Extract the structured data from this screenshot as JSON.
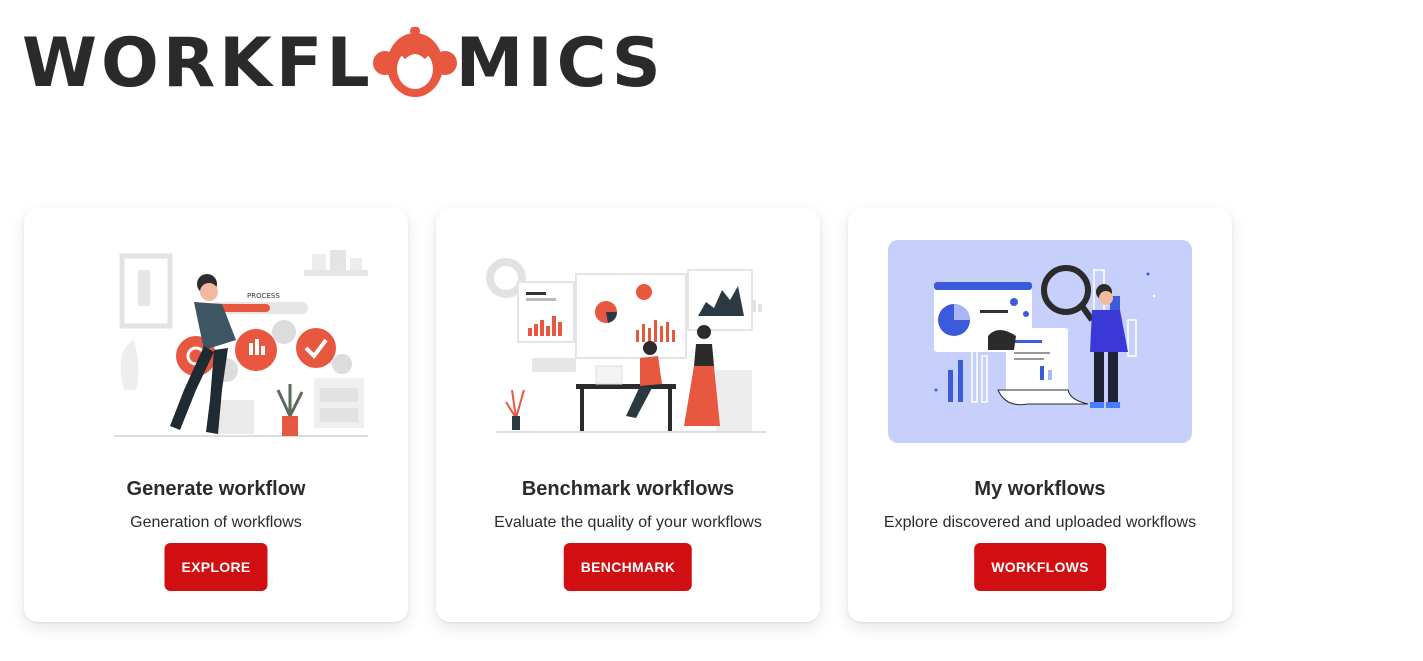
{
  "logo": {
    "text_left": "WORKFL",
    "text_right": "MICS"
  },
  "colors": {
    "accent": "#d10f12",
    "logo_orange": "#e8573f",
    "illustration_bg": "#c7cffb"
  },
  "cards": [
    {
      "title": "Generate workflow",
      "description": "Generation of workflows",
      "button": "EXPLORE",
      "illustration": "process-gears-illustration",
      "illustration_label": "PROCESS"
    },
    {
      "title": "Benchmark workflows",
      "description": "Evaluate the quality of your workflows",
      "button": "BENCHMARK",
      "illustration": "charts-presentation-illustration"
    },
    {
      "title": "My workflows",
      "description": "Explore discovered and uploaded workflows",
      "button": "WORKFLOWS",
      "illustration": "magnifier-analysis-illustration"
    }
  ]
}
